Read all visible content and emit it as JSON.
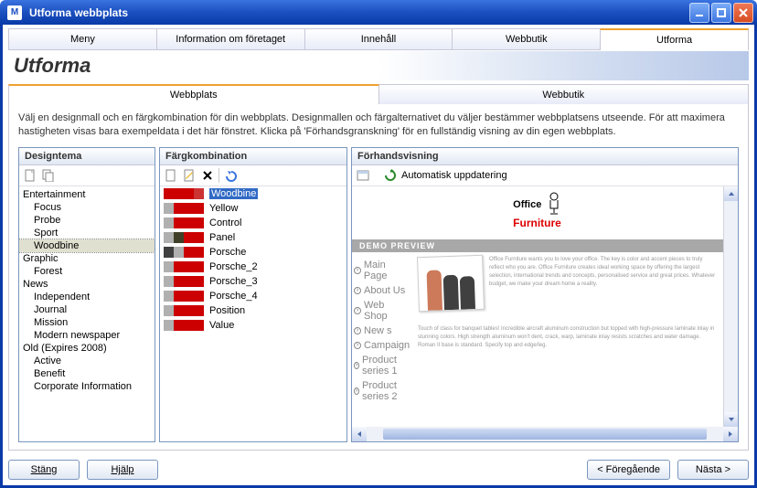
{
  "window": {
    "title": "Utforma webbplats",
    "icon_letter": "M"
  },
  "top_tabs": {
    "items": [
      "Meny",
      "Information om företaget",
      "Innehåll",
      "Webbutik",
      "Utforma"
    ],
    "active_index": 4
  },
  "heading": "Utforma",
  "sub_tabs": {
    "items": [
      "Webbplats",
      "Webbutik"
    ],
    "active_index": 0
  },
  "instruction": "Välj en designmall och en färgkombination för din webbplats. Designmallen och färgalternativet du väljer bestämmer webbplatsens utseende. För att maximera hastigheten visas bara exempeldata i det här fönstret. Klicka på 'Förhandsgranskning' för en fullständig visning av din egen webbplats.",
  "design": {
    "header": "Designtema",
    "groups": [
      {
        "name": "Entertainment",
        "items": [
          "Focus",
          "Probe",
          "Sport",
          "Woodbine"
        ]
      },
      {
        "name": "Graphic",
        "items": [
          "Forest"
        ]
      },
      {
        "name": "News",
        "items": [
          "Independent",
          "Journal",
          "Mission",
          "Modern newspaper"
        ]
      },
      {
        "name": "Old (Expires 2008)",
        "items": [
          "Active",
          "Benefit",
          "Corporate Information"
        ]
      }
    ],
    "selected": "Woodbine"
  },
  "colors": {
    "header": "Färgkombination",
    "toolbar": {
      "new": "new",
      "edit": "edit",
      "delete": "delete",
      "sep": "sep",
      "undo": "undo"
    },
    "items": [
      {
        "name": "Woodbine",
        "swatches": [
          "#cc0000",
          "#cc0000",
          "#cc0000",
          "#cc3333"
        ]
      },
      {
        "name": "Yellow",
        "swatches": [
          "#b0b0b0",
          "#cc0000",
          "#cc0000",
          "#cc0000"
        ]
      },
      {
        "name": "Control",
        "swatches": [
          "#b0b0b0",
          "#cc0000",
          "#cc0000",
          "#cc0000"
        ]
      },
      {
        "name": "Panel",
        "swatches": [
          "#b0b0b0",
          "#404028",
          "#cc0000",
          "#cc0000"
        ]
      },
      {
        "name": "Porsche",
        "swatches": [
          "#404040",
          "#b0b0b0",
          "#cc0000",
          "#cc0000"
        ]
      },
      {
        "name": "Porsche_2",
        "swatches": [
          "#b0b0b0",
          "#cc0000",
          "#cc0000",
          "#cc0000"
        ]
      },
      {
        "name": "Porsche_3",
        "swatches": [
          "#b0b0b0",
          "#cc0000",
          "#cc0000",
          "#cc0000"
        ]
      },
      {
        "name": "Porsche_4",
        "swatches": [
          "#b0b0b0",
          "#cc0000",
          "#cc0000",
          "#cc0000"
        ]
      },
      {
        "name": "Position",
        "swatches": [
          "#b0b0b0",
          "#cc0000",
          "#cc0000",
          "#cc0000"
        ]
      },
      {
        "name": "Value",
        "swatches": [
          "#b0b0b0",
          "#cc0000",
          "#cc0000",
          "#cc0000"
        ]
      }
    ],
    "selected": "Woodbine"
  },
  "preview": {
    "header": "Förhandsvisning",
    "auto_update": "Automatisk uppdatering",
    "logo_line1": "Office",
    "logo_line2": "Furniture",
    "strip": "DEMO PREVIEW",
    "nav": [
      "Main Page",
      "About Us",
      "Web Shop",
      "New s",
      "Campaign",
      "Product series 1",
      "Product series 2"
    ],
    "para1": "Office Furniture wants you to love your office. The key is color and accent pieces to truly reflect who you are. Office Furniture creates ideal working space by offering the largest selection, international trends and concepts, personalised service and great prices. Whatever budget, we make your dream home a reality.",
    "para2": "Touch of class for banquet tables! Incredible aircraft aluminum construction but topped with high-pressure laminate inlay in stunning colors. High strength aluminum won't dent, crack, warp, laminate inlay resists scratches and water damage. Roman II base is standard. Specify top and edge/leg."
  },
  "footer": {
    "close": "Stäng",
    "help": "Hjälp",
    "prev": "< Föregående",
    "next": "Nästa >"
  }
}
